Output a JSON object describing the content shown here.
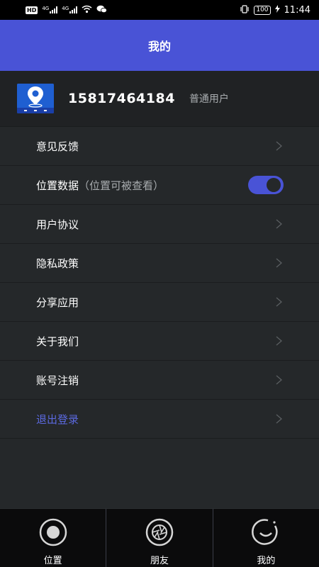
{
  "status_bar": {
    "hd_badge": "HD",
    "sim1_label": "4G",
    "sim2_label": "4G",
    "battery": "100",
    "time": "11:44"
  },
  "header": {
    "title": "我的"
  },
  "profile": {
    "phone": "15817464184",
    "user_type": "普通用户",
    "logo_icon": "map-pin-icon"
  },
  "menu": {
    "items": [
      {
        "label": "意见反馈"
      },
      {
        "label": "位置数据",
        "sub": "（位置可被查看）",
        "toggle_on": true
      },
      {
        "label": "用户协议"
      },
      {
        "label": "隐私政策"
      },
      {
        "label": "分享应用"
      },
      {
        "label": "关于我们"
      },
      {
        "label": "账号注销"
      },
      {
        "label": "退出登录"
      }
    ]
  },
  "tabs": [
    {
      "label": "位置",
      "icon": "location-ring-icon"
    },
    {
      "label": "朋友",
      "icon": "aperture-icon"
    },
    {
      "label": "我的",
      "icon": "smile-ring-icon"
    }
  ],
  "colors": {
    "accent": "#4953d6",
    "background": "#25282a",
    "logout_text": "#5b69e0"
  }
}
